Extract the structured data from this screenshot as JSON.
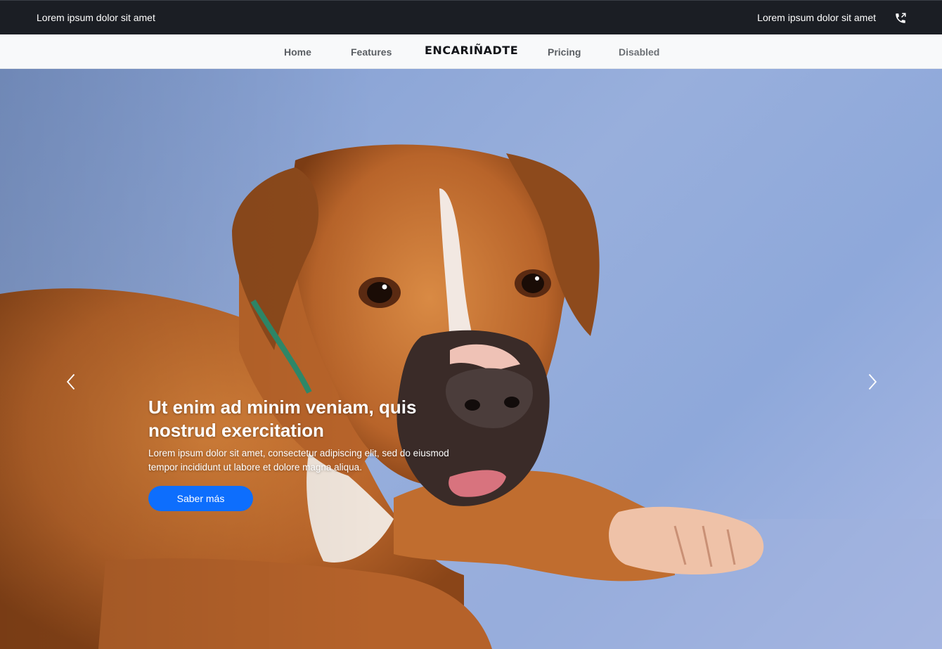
{
  "topbar": {
    "left_text": "Lorem ipsum dolor sit amet",
    "right_text": "Lorem ipsum dolor sit amet",
    "phone_icon": "phone-call-icon"
  },
  "nav": {
    "items": [
      {
        "label": "Home"
      },
      {
        "label": "Features"
      },
      {
        "label": "Pricing"
      },
      {
        "label": "Disabled",
        "disabled": true
      }
    ],
    "brand": "ENCARIÑADTE"
  },
  "hero": {
    "image": "boxer-dog-photo",
    "title": "Ut enim ad minim veniam, quis nostrud exercitation",
    "text": "Lorem ipsum dolor sit amet, consectetur adipiscing elit, sed do eiusmod tempor incididunt ut labore et dolore magna aliqua.",
    "button_label": "Saber más",
    "prev_icon": "chevron-left-icon",
    "next_icon": "chevron-right-icon"
  },
  "colors": {
    "topbar_bg": "#1b1e24",
    "nav_bg": "#f8f9fa",
    "accent": "#0d6efd",
    "hero_bg": "#8ea8da"
  }
}
